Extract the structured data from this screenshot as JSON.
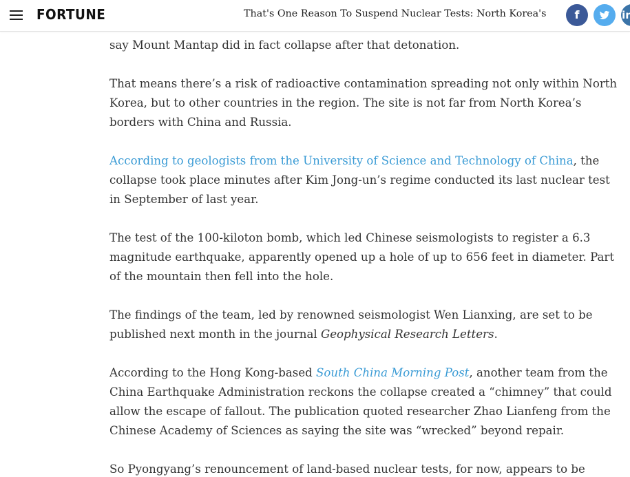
{
  "header": {
    "logo": "FORTUNE",
    "headline": "That's One Reason To Suspend Nuclear Tests: North Korea's ...",
    "share": {
      "facebook_glyph": "f",
      "twitter_glyph": "❀",
      "linkedin_glyph": "in"
    },
    "colors": {
      "facebook": "#3b5998",
      "twitter": "#55acee",
      "linkedin": "#3b74a8"
    }
  },
  "article": {
    "p0_line2": "say Mount Mantap did in fact collapse after that detonation.",
    "p1": [
      "That means there’s a risk of radioactive contamination spreading not only within North",
      "Korea, but to other countries in the region. The site is not far from North Korea’s",
      "borders with China and Russia."
    ],
    "p2_link": "According to geologists from the University of Science and Technology of China",
    "p2_line1_rest": ", the",
    "p2_rest": [
      "collapse took place minutes after Kim Jong-un’s regime conducted its last nuclear test",
      "in September of last year."
    ],
    "p3": [
      "The test of the 100-kiloton bomb, which led Chinese seismologists to register a 6.3",
      "magnitude earthquake, apparently opened up a hole of up to 656 feet in diameter. Part",
      "of the mountain then fell into the hole."
    ],
    "p4_line1": "The findings of the team, led by renowned seismologist Wen Lianxing, are set to be",
    "p4_line2_start": "published next month in the journal ",
    "p4_journal": "Geophysical Research Letters",
    "p4_line2_end": ".",
    "p5_line1_start": "According to the Hong Kong-based ",
    "p5_link": "South China Morning Post",
    "p5_line1_end": ", another team from the",
    "p5_rest": [
      "China Earthquake Administration reckons the collapse created a “chimney” that could",
      "allow the escape of fallout. The publication quoted researcher Zhao Lianfeng from the",
      "Chinese Academy of Sciences as saying the site was “wrecked” beyond repair."
    ],
    "p6_line1": "So Pyongyang’s renouncement of land-based nuclear tests, for now, appears to be",
    "link_color": "#3a9bd5"
  }
}
